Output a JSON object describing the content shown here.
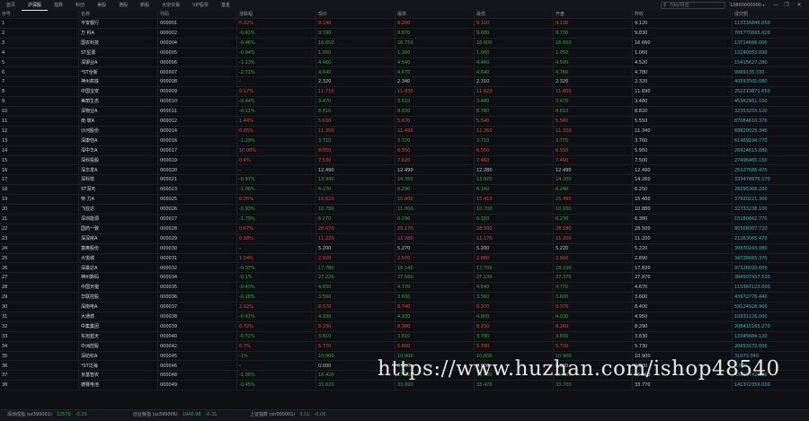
{
  "tabs": [
    {
      "label": "首页",
      "active": false
    },
    {
      "label": "沪深股",
      "active": true
    },
    {
      "label": "指数",
      "active": false
    },
    {
      "label": "科创",
      "active": false
    },
    {
      "label": "美股",
      "active": false
    },
    {
      "label": "港股",
      "active": false
    },
    {
      "label": "新股",
      "active": false
    },
    {
      "label": "大宗交易",
      "active": false
    },
    {
      "label": "VIP股票",
      "active": false
    },
    {
      "label": "基金",
      "active": false
    }
  ],
  "search": {
    "placeholder": "代码/拼音"
  },
  "user": {
    "phone": "13800000000"
  },
  "window": {
    "minimize": "—",
    "restore": "❐",
    "close": "✕"
  },
  "columns": [
    "序号",
    "名称",
    "代码",
    "涨跌幅",
    "现价",
    "最高",
    "最低",
    "开盘",
    "昨收",
    "成交额"
  ],
  "rows": [
    [
      "1",
      "平安银行",
      "000001",
      "0.22%",
      "9.140",
      "9.200",
      "9.110",
      "9.130",
      "9.120",
      "113316846.050"
    ],
    [
      "2",
      "万 科A",
      "000002",
      "-0.41%",
      "9.790",
      "9.870",
      "9.680",
      "9.730",
      "9.830",
      "705770665.620"
    ],
    [
      "3",
      "国农科技",
      "000004",
      "-0.46%",
      "16.650",
      "16.750",
      "16.600",
      "16.650",
      "16.660",
      "13714666.000"
    ],
    [
      "4",
      "ST星源",
      "000005",
      "-0.94%",
      "1.050",
      "1.100",
      "1.060",
      "1.050",
      "1.060",
      "13240053.090"
    ],
    [
      "5",
      "深振业A",
      "000006",
      "-1.13%",
      "4.460",
      "4.540",
      "4.460",
      "4.500",
      "4.520",
      "15415627.280"
    ],
    [
      "6",
      "*ST全新",
      "000007",
      "-2.71%",
      "4.640",
      "4.670",
      "4.640",
      "4.760",
      "4.780",
      "9969135.330"
    ],
    [
      "7",
      "神州高铁",
      "000008",
      "-",
      "2.320",
      "2.340",
      "2.310",
      "2.320",
      "2.320",
      "40593501.080"
    ],
    [
      "8",
      "中国宝安",
      "000009",
      "0.17%",
      "11.710",
      "11.830",
      "11.620",
      "11.600",
      "11.690",
      "252213871.650"
    ],
    [
      "9",
      "美丽生态",
      "000010",
      "-0.44%",
      "3.470",
      "3.510",
      "3.480",
      "3.470",
      "3.480",
      "45562951.100"
    ],
    [
      "10",
      "深物业A",
      "000011",
      "-0.11%",
      "8.810",
      "8.930",
      "8.780",
      "8.810",
      "8.820",
      "32353255.120"
    ],
    [
      "11",
      "南 玻A",
      "000012",
      "1.44%",
      "5.630",
      "5.670",
      "5.540",
      "5.560",
      "5.550",
      "87084610.370"
    ],
    [
      "12",
      "沙河股份",
      "000014",
      "0.05%",
      "11.350",
      "11.430",
      "11.260",
      "11.320",
      "11.340",
      "68820029.340"
    ],
    [
      "13",
      "深康佳A",
      "000016",
      "-1.29%",
      "3.710",
      "3.770",
      "3.710",
      "3.770",
      "3.760",
      "61469194.770"
    ],
    [
      "14",
      "深中华A",
      "000017",
      "10.00%",
      "6.550",
      "6.550",
      "6.550",
      "6.550",
      "5.950",
      "26924615.080"
    ],
    [
      "15",
      "深科投股",
      "000019",
      "0.4%",
      "7.530",
      "7.620",
      "7.460",
      "7.490",
      "7.500",
      "27496465.150"
    ],
    [
      "16",
      "深华发A",
      "000020",
      "-",
      "12.490",
      "12.490",
      "12.280",
      "12.490",
      "12.490",
      "25327586.470"
    ],
    [
      "17",
      "深科技",
      "000021",
      "-0.97%",
      "13.940",
      "14.350",
      "13.920",
      "14.200",
      "14.260",
      "333478676.170"
    ],
    [
      "18",
      "ST深天",
      "000023",
      "-1.06%",
      "6.170",
      "6.290",
      "6.140",
      "6.240",
      "6.250",
      "26095306.200"
    ],
    [
      "19",
      "特 力A",
      "000025",
      "0.35%",
      "15.520",
      "15.600",
      "15.410",
      "15.490",
      "15.460",
      "37920221.300"
    ],
    [
      "20",
      "飞亚达",
      "000026",
      "-0.93%",
      "10.780",
      "11.000",
      "10.700",
      "10.930",
      "10.880",
      "32733238.100"
    ],
    [
      "21",
      "深圳能源",
      "000027",
      "-1.79%",
      "6.270",
      "6.290",
      "6.150",
      "6.230",
      "6.380",
      "15180662.770"
    ],
    [
      "22",
      "国药一致",
      "000028",
      "0.67%",
      "28.670",
      "29.170",
      "28.500",
      "28.580",
      "28.500",
      "80568007.720"
    ],
    [
      "23",
      "深深房A",
      "000029",
      "0.18%",
      "11.220",
      "11.380",
      "11.170",
      "11.200",
      "11.200",
      "21263065.470"
    ],
    [
      "24",
      "富奥股份",
      "000030",
      "-",
      "5.200",
      "5.270",
      "5.200",
      "5.220",
      "5.220",
      "30670243.080"
    ],
    [
      "25",
      "大悦城",
      "000031",
      "1.04%",
      "2.920",
      "2.970",
      "2.880",
      "2.900",
      "2.890",
      "34726665.370"
    ],
    [
      "26",
      "深桑达A",
      "000032",
      "-0.37%",
      "17.780",
      "18.140",
      "17.700",
      "18.100",
      "17.820",
      "97326020.600"
    ],
    [
      "27",
      "神州数码",
      "000034",
      "-0.1%",
      "27.220",
      "27.560",
      "27.130",
      "27.370",
      "27.870",
      "384507437.530"
    ],
    [
      "28",
      "中国天楹",
      "000035",
      "-0.43%",
      "4.650",
      "4.770",
      "4.640",
      "4.770",
      "4.670",
      "113367123.000"
    ],
    [
      "29",
      "华联控股",
      "000036",
      "-0.28%",
      "3.590",
      "3.600",
      "3.560",
      "3.600",
      "3.600",
      "43972776.440"
    ],
    [
      "30",
      "深南电A",
      "000037",
      "2.02%",
      "8.570",
      "8.740",
      "8.370",
      "8.370",
      "8.400",
      "59124928.900"
    ],
    [
      "31",
      "大通燃",
      "000038",
      "-0.41%",
      "4.930",
      "4.930",
      "4.800",
      "4.930",
      "4.950",
      "10931126.000"
    ],
    [
      "32",
      "中集集团",
      "000039",
      "0.72%",
      "8.330",
      "8.380",
      "8.250",
      "8.260",
      "8.290",
      "208415165.270"
    ],
    [
      "33",
      "东旭蓝天",
      "000040",
      "-0.72%",
      "3.810",
      "3.810",
      "3.780",
      "3.830",
      "3.830",
      "13345684.120"
    ],
    [
      "34",
      "中洲控股",
      "000042",
      "0.7%",
      "5.770",
      "5.800",
      "5.700",
      "5.730",
      "5.730",
      "20653172.000"
    ],
    [
      "35",
      "深纺织A",
      "000045",
      "-1%",
      "10.900",
      "10.900",
      "10.830",
      "10.900",
      "10.900",
      "31073.040"
    ],
    [
      "36",
      "*ST泛海",
      "000046",
      "-",
      "0.000",
      "0.000",
      "0.000",
      "0.000",
      "0.000",
      "0.000"
    ],
    [
      "37",
      "京基智农",
      "000048",
      "-1.06%",
      "16.420",
      "17.020",
      "16.400",
      "16.900",
      "16.910",
      "43315742.160"
    ],
    [
      "38",
      "德赛电池",
      "000049",
      "-0.45%",
      "33.620",
      "33.990",
      "33.470",
      "33.700",
      "33.770",
      "141372356.030"
    ]
  ],
  "status_bar": [
    {
      "name": "深圳成指 (sz399001)",
      "value": "12570",
      "change": "-0.20",
      "dir": "dn"
    },
    {
      "name": "创业板指 (sz399006)",
      "value": "1940.98",
      "change": "-0.31",
      "dir": "dn"
    },
    {
      "name": "上证指数 (sh000001)",
      "value": "3.11",
      "change": "-0.06",
      "dir": "dn"
    }
  ],
  "watermark": "https://www.huzhan.com/ishop48540",
  "colors": {
    "up": "#e0493b",
    "down": "#2fae3c",
    "amount": "#3fb6c6",
    "background": "#0e0f13"
  }
}
